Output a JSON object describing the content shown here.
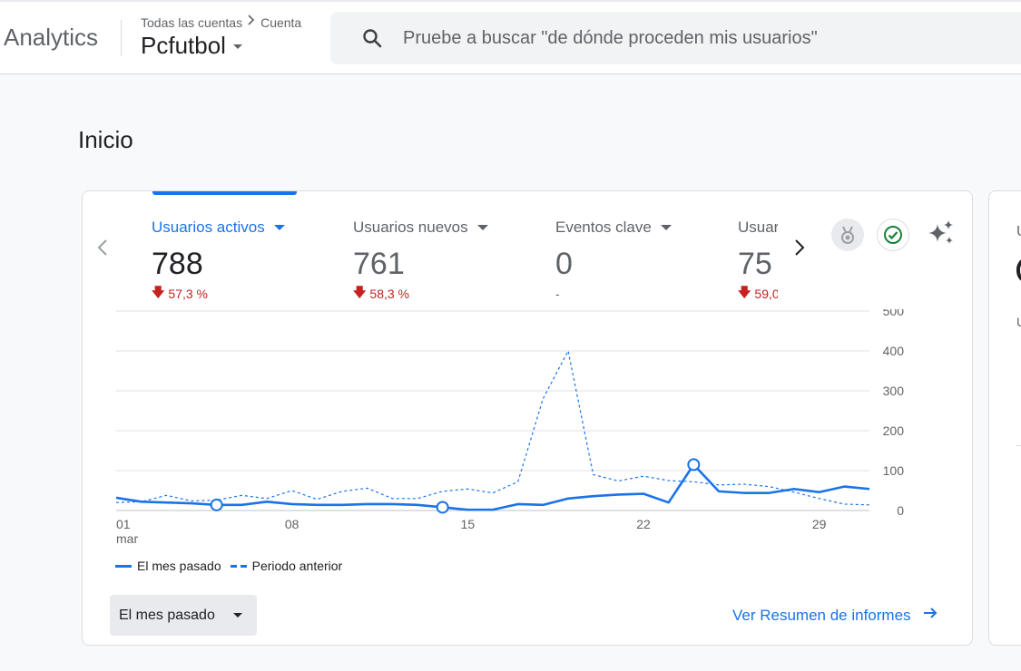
{
  "app": {
    "title": "Analytics"
  },
  "breadcrumb": {
    "root": "Todas las cuentas",
    "current": "Cuenta"
  },
  "property": {
    "name": "Pcfutbol"
  },
  "search": {
    "placeholder": "Pruebe a buscar \"de dónde proceden mis usuarios\""
  },
  "page": {
    "title": "Inicio"
  },
  "metrics": [
    {
      "label": "Usuarios activos",
      "value": "788",
      "change": "57,3 %",
      "direction": "down",
      "active": true
    },
    {
      "label": "Usuarios nuevos",
      "value": "761",
      "change": "58,3 %",
      "direction": "down"
    },
    {
      "label": "Eventos clave",
      "value": "0",
      "change": "-",
      "direction": "none"
    },
    {
      "label": "Usuar",
      "value": "75",
      "change": "59,0",
      "direction": "down"
    }
  ],
  "second_card": {
    "label_top": "U",
    "label_mid": "U"
  },
  "legend": {
    "current": "El mes pasado",
    "previous": "Periodo anterior"
  },
  "period_selector": {
    "label": "El mes pasado"
  },
  "report_link": {
    "label": "Ver Resumen de informes"
  },
  "colors": {
    "accent": "#1a73e8",
    "negative": "#c5221f",
    "grid": "#e0e0e0"
  },
  "icons": [
    "search-icon",
    "chevron-right-icon",
    "chevron-left-icon",
    "award-icon",
    "check-circle-icon",
    "sparkle-icon",
    "arrow-down-icon",
    "arrow-right-icon"
  ],
  "chart_data": {
    "type": "line",
    "title": "",
    "xlabel": "",
    "ylabel": "",
    "ylim": [
      0,
      500
    ],
    "yticks": [
      "500",
      "400",
      "300",
      "200",
      "100",
      "0"
    ],
    "xticks": [
      {
        "day": 1,
        "label": "01",
        "sublabel": "mar"
      },
      {
        "day": 8,
        "label": "08"
      },
      {
        "day": 15,
        "label": "15"
      },
      {
        "day": 22,
        "label": "22"
      },
      {
        "day": 29,
        "label": "29"
      }
    ],
    "x": [
      1,
      2,
      3,
      4,
      5,
      6,
      7,
      8,
      9,
      10,
      11,
      12,
      13,
      14,
      15,
      16,
      17,
      18,
      19,
      20,
      21,
      22,
      23,
      24,
      25,
      26,
      27,
      28,
      29,
      30,
      31
    ],
    "series": [
      {
        "name": "El mes pasado",
        "style": "solid",
        "values": [
          32,
          22,
          20,
          18,
          14,
          14,
          22,
          16,
          14,
          14,
          16,
          16,
          14,
          8,
          2,
          2,
          16,
          14,
          30,
          36,
          40,
          42,
          20,
          115,
          48,
          44,
          44,
          54,
          46,
          60,
          54
        ],
        "markers": [
          5,
          14,
          24
        ]
      },
      {
        "name": "Periodo anterior",
        "style": "dashed",
        "values": [
          20,
          22,
          38,
          24,
          26,
          38,
          30,
          50,
          28,
          48,
          56,
          30,
          30,
          48,
          54,
          44,
          72,
          280,
          400,
          90,
          74,
          86,
          75,
          72,
          64,
          66,
          60,
          46,
          30,
          16,
          14
        ]
      }
    ],
    "legend_position": "bottom-left",
    "grid": true
  }
}
